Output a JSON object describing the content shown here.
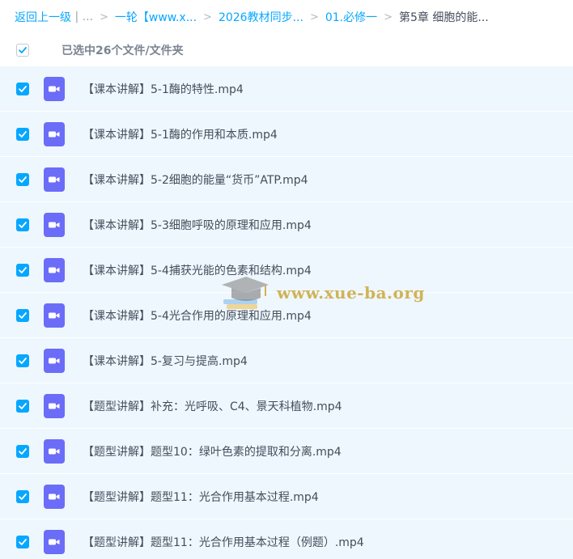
{
  "breadcrumb": {
    "back_label": "返回上一级",
    "ellipsis": "...",
    "separator": ">",
    "items": [
      {
        "label": "一轮【www.x..."
      },
      {
        "label": "2026教材同步..."
      },
      {
        "label": "01.必修一"
      }
    ],
    "current": "第5章 细胞的能..."
  },
  "selection": {
    "summary": "已选中26个文件/文件夹",
    "all_checked": false
  },
  "files": [
    {
      "name": "【课本讲解】5-1酶的特性.mp4",
      "checked": true,
      "type": "video-file-icon"
    },
    {
      "name": "【课本讲解】5-1酶的作用和本质.mp4",
      "checked": true,
      "type": "video-file-icon"
    },
    {
      "name": "【课本讲解】5-2细胞的能量“货币”ATP.mp4",
      "checked": true,
      "type": "video-file-icon"
    },
    {
      "name": "【课本讲解】5-3细胞呼吸的原理和应用.mp4",
      "checked": true,
      "type": "video-file-icon"
    },
    {
      "name": "【课本讲解】5-4捕获光能的色素和结构.mp4",
      "checked": true,
      "type": "video-file-icon"
    },
    {
      "name": "【课本讲解】5-4光合作用的原理和应用.mp4",
      "checked": true,
      "type": "video-file-icon"
    },
    {
      "name": "【课本讲解】5-复习与提高.mp4",
      "checked": true,
      "type": "video-file-icon"
    },
    {
      "name": "【题型讲解】补充：光呼吸、C4、景天科植物.mp4",
      "checked": true,
      "type": "video-file-icon"
    },
    {
      "name": "【题型讲解】题型10：绿叶色素的提取和分离.mp4",
      "checked": true,
      "type": "video-file-icon"
    },
    {
      "name": "【题型讲解】题型11：光合作用基本过程.mp4",
      "checked": true,
      "type": "video-file-icon"
    },
    {
      "name": "【题型讲解】题型11：光合作用基本过程（例题）.mp4",
      "checked": true,
      "type": "video-file-icon"
    }
  ],
  "watermark": {
    "text": "www.xue-ba.org",
    "icon": "graduation-cap-icon"
  },
  "colors": {
    "accent": "#06a7ff",
    "row_background": "#eef7fe",
    "video_icon": "#6b6cf8",
    "text": "#454d5a",
    "muted": "#7b8493"
  }
}
